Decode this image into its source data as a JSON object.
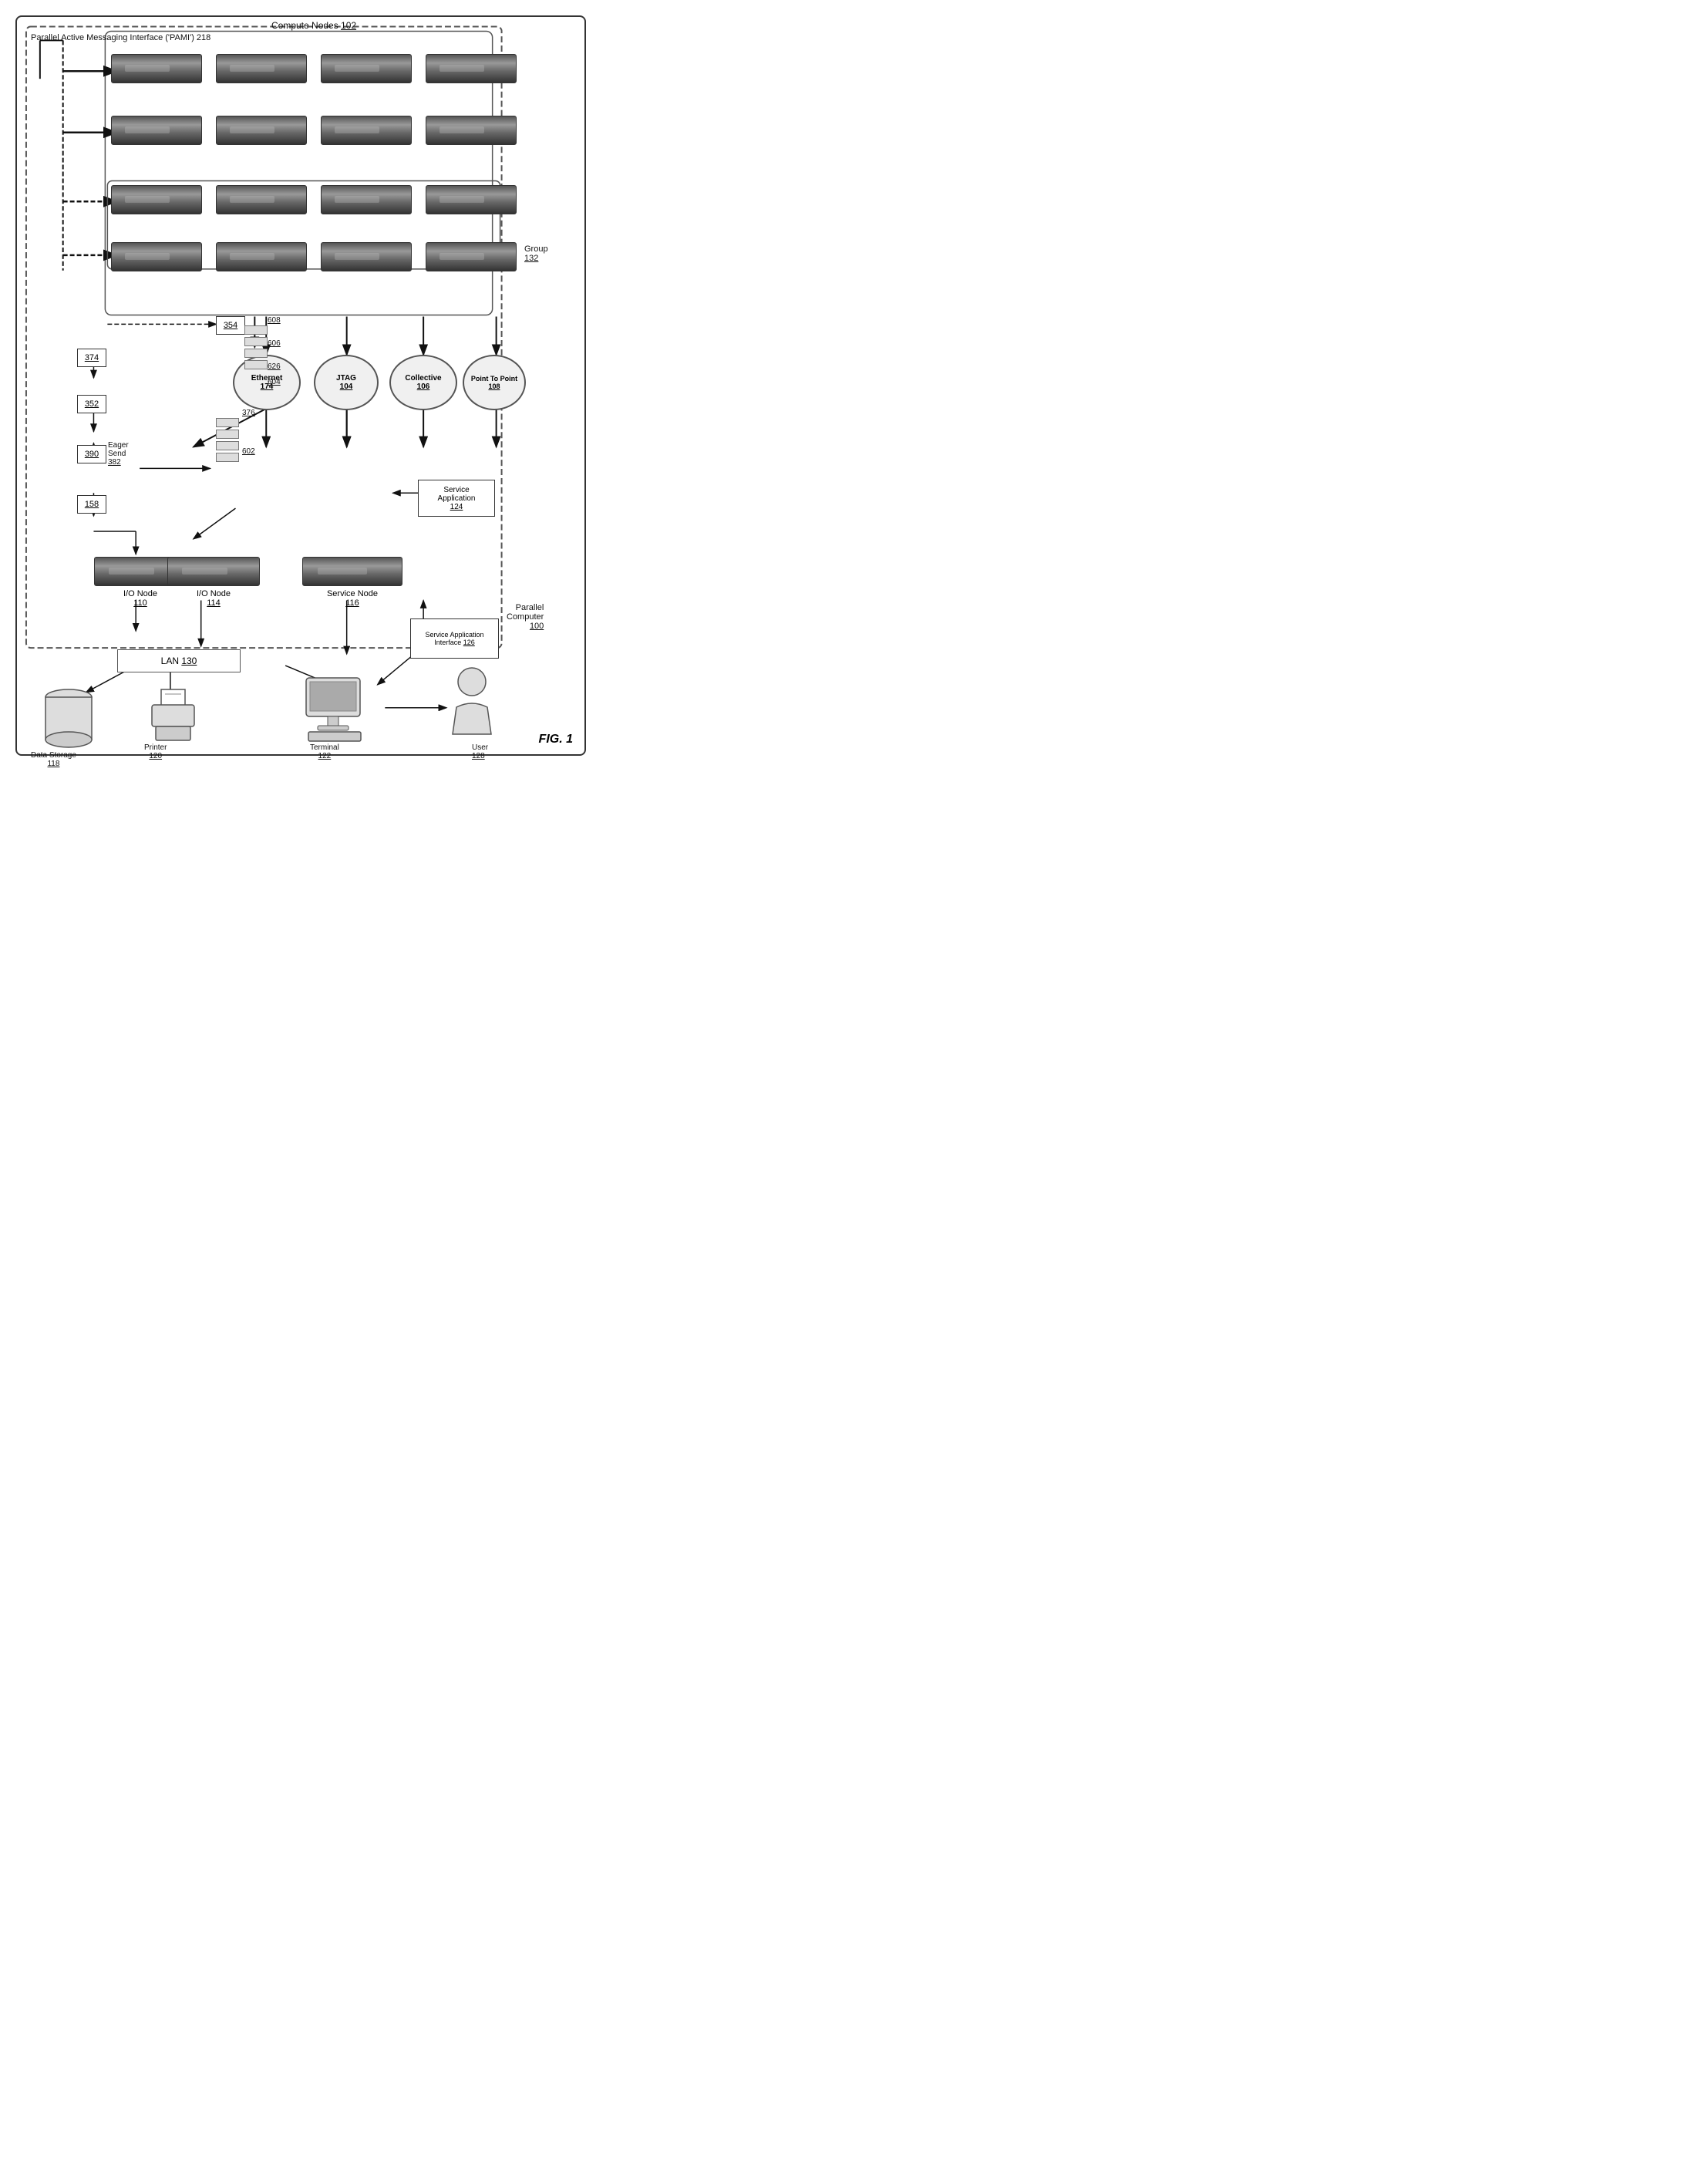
{
  "title": "FIG. 1",
  "labels": {
    "pami": "Parallel Active Messaging Interface ('PAMI') 218",
    "compute_nodes": "Compute Nodes 102",
    "group": "Group 132",
    "parallel_computer": "Parallel Computer 100",
    "lan": "LAN 130",
    "ethernet": "Ethernet 174",
    "jtag": "JTAG 104",
    "collective": "Collective 106",
    "point_to_point": "Point To Point 108",
    "io_node_110": "I/O Node 110",
    "io_node_114": "I/O Node 114",
    "service_node": "Service Node 116",
    "service_app": "Service Application 124",
    "service_app_iface": "Service Application Interface 126",
    "data_storage": "Data Storage 118",
    "printer": "Printer 120",
    "terminal": "Terminal 122",
    "user": "User 128",
    "ref_374": "374",
    "ref_354": "354",
    "ref_352": "352",
    "ref_390": "390",
    "ref_158": "158",
    "ref_382": "Eager Send 382",
    "ref_376": "376",
    "ref_602": "602",
    "ref_604": "604",
    "ref_606": "606",
    "ref_608": "608",
    "ref_626": "626",
    "fig": "FIG. 1"
  }
}
